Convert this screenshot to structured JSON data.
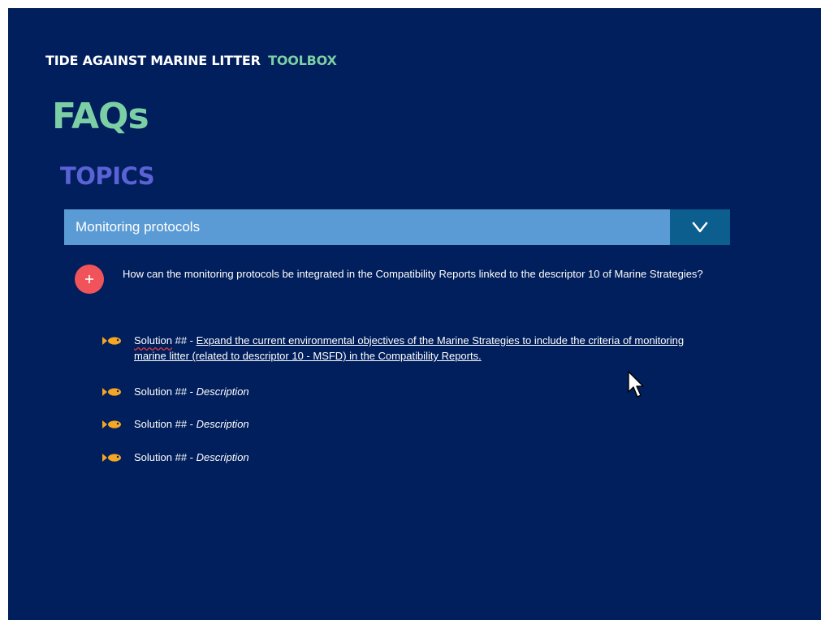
{
  "header": {
    "brand_main": "TIDE AGAINST MARINE LITTER",
    "brand_accent": "TOOLBOX"
  },
  "page": {
    "title": "FAQs",
    "subtitle": "TOPICS"
  },
  "topic": {
    "label": "Monitoring protocols",
    "toggle_icon": "chevron-down-icon"
  },
  "question": {
    "icon": "plus-icon",
    "text": "How can the monitoring protocols be integrated in the Compatibility Reports linked to the descriptor 10 of Marine Strategies?"
  },
  "solutions": [
    {
      "label": "Solution",
      "suffix": " ## - ",
      "link": "Expand the current environmental objectives of the Marine Strategies  to include the criteria of monitoring marine litter (related to descriptor 10 - MSFD) in the Compatibility Reports."
    },
    {
      "label": "Solution ##",
      "sep": " - ",
      "description": "Description"
    },
    {
      "label": "Solution ##",
      "sep": " - ",
      "description": "Description"
    },
    {
      "label": "Solution ##",
      "sep": " - ",
      "description": "Description"
    }
  ],
  "colors": {
    "background": "#011f5c",
    "accent_green": "#7ccfa5",
    "topics_blue": "#5a62d6",
    "topic_bar": "#5b9bd5",
    "toggle_bg": "#0b5e8e",
    "plus_red": "#f0545a",
    "fish_orange": "#f5a623"
  },
  "icons": {
    "bullet": "fish-icon",
    "pointer": "mouse-cursor-icon"
  }
}
